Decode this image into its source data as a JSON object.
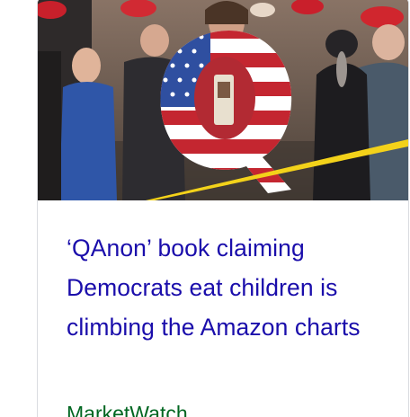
{
  "news_card": {
    "headline": "‘QAnon’ book claiming Democrats eat children is climbing the Amazon charts",
    "source": "MarketWatch",
    "image_alt": "Rally crowd with a man holding a large Q painted with the American flag",
    "image_sign_text": "Q"
  },
  "colors": {
    "headline": "#1a0dab",
    "source": "#006621",
    "card_border": "#dadce0"
  }
}
